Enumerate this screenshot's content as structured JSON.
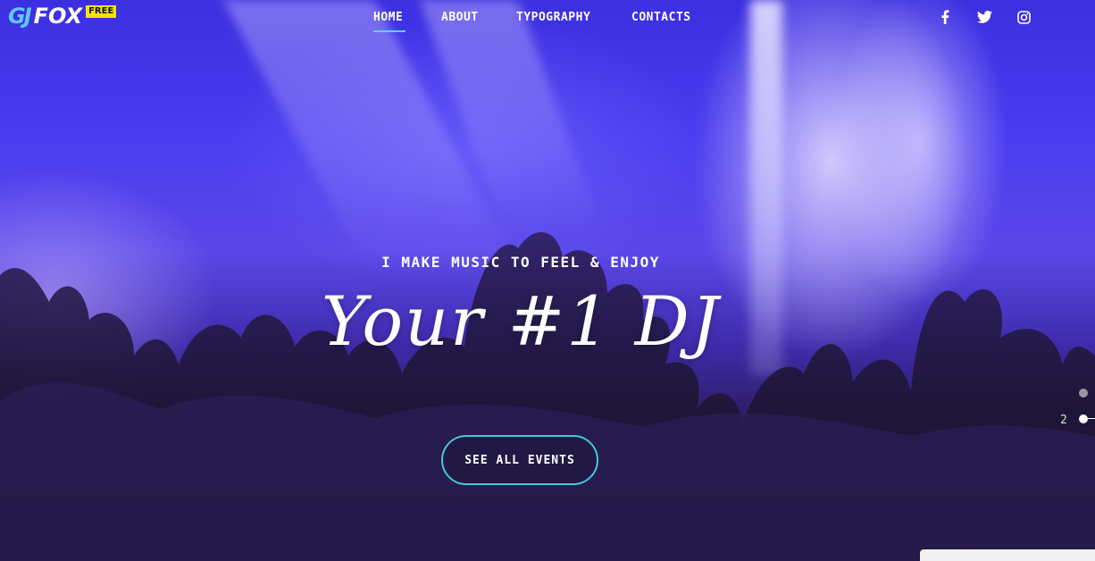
{
  "header": {
    "logo": {
      "mark": "GJ",
      "name": "FOX",
      "badge": "FREE"
    },
    "nav": [
      {
        "label": "HOME",
        "active": true
      },
      {
        "label": "ABOUT",
        "active": false
      },
      {
        "label": "TYPOGRAPHY",
        "active": false
      },
      {
        "label": "CONTACTS",
        "active": false
      }
    ],
    "social": [
      "facebook-icon",
      "twitter-icon",
      "instagram-icon"
    ]
  },
  "hero": {
    "tagline": "I MAKE MUSIC TO FEEL & ENJOY",
    "headline": "Your #1 DJ",
    "cta_label": "SEE ALL EVENTS"
  },
  "pager": {
    "current": "2"
  },
  "colors": {
    "accent": "#48c7d6",
    "badge": "#f5e400",
    "background": "#3b2fe0"
  }
}
